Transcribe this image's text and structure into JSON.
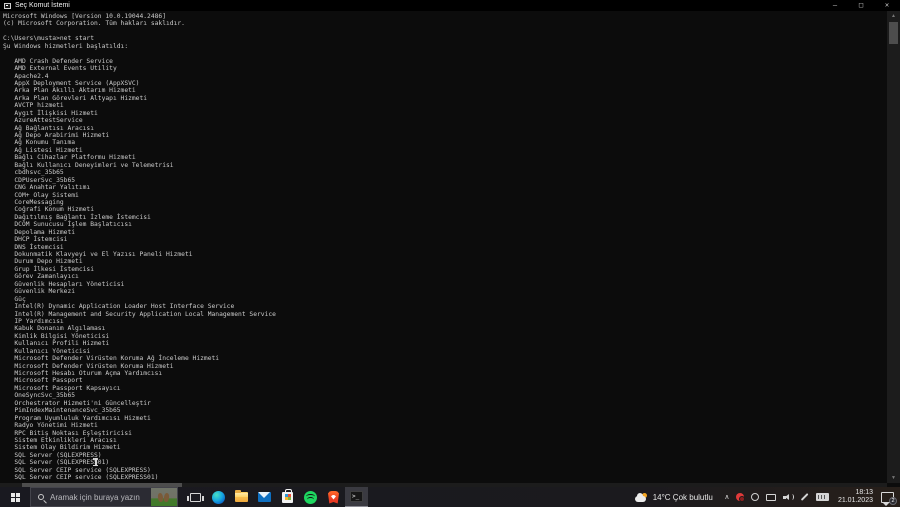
{
  "window": {
    "title": "Seç Komut İstemi",
    "controls": {
      "minimize": "–",
      "maximize": "□",
      "close": "✕"
    }
  },
  "console": {
    "colors": {
      "background": "#0c0c0c",
      "text": "#cccccc"
    },
    "lines": [
      "Microsoft Windows [Version 10.0.19044.2486]",
      "(c) Microsoft Corporation. Tüm hakları saklıdır.",
      "",
      "C:\\Users\\musta>net start",
      "Şu Windows hizmetleri başlatıldı:",
      "",
      "   AMD Crash Defender Service",
      "   AMD External Events Utility",
      "   Apache2.4",
      "   AppX Deployment Service (AppXSVC)",
      "   Arka Plan Akıllı Aktarım Hizmeti",
      "   Arka Plan Görevleri Altyapı Hizmeti",
      "   AVCTP hizmeti",
      "   Aygıt İlişkisi Hizmeti",
      "   AzureAttestService",
      "   Ağ Bağlantısı Aracısı",
      "   Ağ Depo Arabirimi Hizmeti",
      "   Ağ Konumu Tanıma",
      "   Ağ Listesi Hizmeti",
      "   Bağlı Cihazlar Platformu Hizmeti",
      "   Bağlı Kullanıcı Deneyimleri ve Telemetrisi",
      "   cbdhsvc_35b65",
      "   CDPUserSvc_35b65",
      "   CNG Anahtar Yalıtımı",
      "   COM+ Olay Sistemi",
      "   CoreMessaging",
      "   Coğrafi Konum Hizmeti",
      "   Dağıtılmış Bağlantı İzleme İstemcisi",
      "   DCOM Sunucusu İşlem Başlatıcısı",
      "   Depolama Hizmeti",
      "   DHCP İstemcisi",
      "   DNS İstemcisi",
      "   Dokunmatik Klavyeyi ve El Yazısı Paneli Hizmeti",
      "   Durum Depo Hizmeti",
      "   Grup İlkesi İstemcisi",
      "   Görev Zamanlayıcı",
      "   Güvenlik Hesapları Yöneticisi",
      "   Güvenlik Merkezi",
      "   Güç",
      "   Intel(R) Dynamic Application Loader Host Interface Service",
      "   Intel(R) Management and Security Application Local Management Service",
      "   IP Yardımcısı",
      "   Kabuk Donanım Algılaması",
      "   Kimlik Bilgisi Yöneticisi",
      "   Kullanıcı Profili Hizmeti",
      "   Kullanıcı Yöneticisi",
      "   Microsoft Defender Virüsten Koruma Ağ İnceleme Hizmeti",
      "   Microsoft Defender Virüsten Koruma Hizmeti",
      "   Microsoft Hesabı Oturum Açma Yardımcısı",
      "   Microsoft Passport",
      "   Microsoft Passport Kapsayıcı",
      "   OneSyncSvc_35b65",
      "   Orchestrator Hizmeti'ni Güncelleştir",
      "   PimIndexMaintenanceSvc_35b65",
      "   Program Uyumluluk Yardımcısı Hizmeti",
      "   Radyo Yönetimi Hizmeti",
      "   RPC Bitiş Noktası Eşleştiricisi",
      "   Sistem Etkinlikleri Aracısı",
      "   Sistem Olay Bildirim Hizmeti",
      "   SQL Server (SQLEXPRESS)",
      "   SQL Server (SQLEXPRESS01)",
      "   SQL Server CEIP service (SQLEXPRESS)",
      "   SQL Server CEIP service (SQLEXPRESS01)"
    ]
  },
  "taskbar": {
    "search": {
      "placeholder": "Aramak için buraya yazın"
    },
    "app_icons": [
      "task-view",
      "edge",
      "file-explorer",
      "mail",
      "microsoft-store",
      "spotify",
      "brave",
      "command-prompt"
    ],
    "active_app": "command-prompt",
    "weather": {
      "temp": "14°C",
      "condition": "Çok bulutlu",
      "label": "14°C Çok bulutlu"
    },
    "clock": {
      "time": "18:13",
      "date": "21.01.2023"
    },
    "action_center": {
      "badge": "2"
    }
  }
}
